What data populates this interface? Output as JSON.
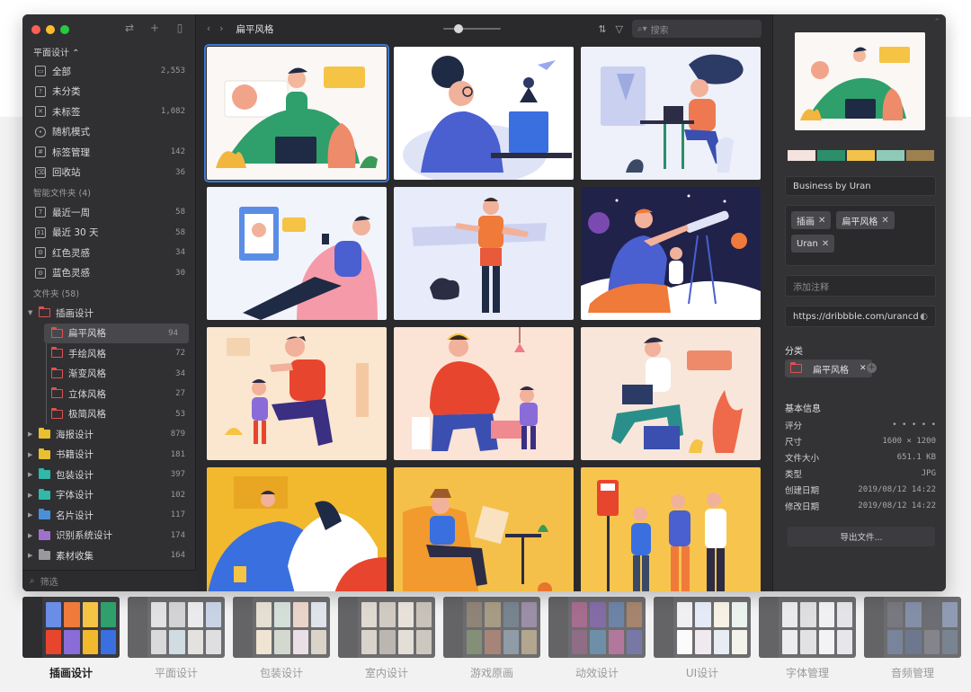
{
  "sidebar": {
    "library": "平面设计 ⌃",
    "items": [
      {
        "label": "全部",
        "count": "2,553",
        "icon": "all-icon"
      },
      {
        "label": "未分类",
        "count": "",
        "icon": "uncategorized-icon"
      },
      {
        "label": "未标签",
        "count": "1,082",
        "icon": "untagged-icon"
      },
      {
        "label": "随机模式",
        "count": "",
        "icon": "random-icon"
      },
      {
        "label": "标签管理",
        "count": "142",
        "icon": "tag-manage-icon"
      },
      {
        "label": "回收站",
        "count": "36",
        "icon": "trash-icon"
      }
    ],
    "smart_section": "智能文件夹 (4)",
    "smart_items": [
      {
        "label": "最近一周",
        "count": "58",
        "icon": "calendar-7-icon"
      },
      {
        "label": "最近 30 天",
        "count": "58",
        "icon": "calendar-31-icon"
      },
      {
        "label": "红色灵感",
        "count": "34",
        "icon": "smart-folder-icon"
      },
      {
        "label": "蓝色灵感",
        "count": "30",
        "icon": "smart-folder-icon"
      }
    ],
    "folder_section": "文件夹 (58)",
    "folders": [
      {
        "label": "插画设计",
        "count": "",
        "color": "#e05050",
        "expanded": true
      },
      {
        "label": "海报设计",
        "count": "879",
        "color": "#e8c030"
      },
      {
        "label": "书籍设计",
        "count": "181",
        "color": "#e8c030"
      },
      {
        "label": "包装设计",
        "count": "397",
        "color": "#30b8a8"
      },
      {
        "label": "字体设计",
        "count": "102",
        "color": "#30b8a8"
      },
      {
        "label": "名片设计",
        "count": "117",
        "color": "#4a90d8"
      },
      {
        "label": "识别系统设计",
        "count": "174",
        "color": "#a070d0"
      },
      {
        "label": "素材收集",
        "count": "164",
        "color": "#9a9a9e"
      }
    ],
    "subfolders": [
      {
        "label": "扁平风格",
        "count": "94"
      },
      {
        "label": "手绘风格",
        "count": "72"
      },
      {
        "label": "渐变风格",
        "count": "34"
      },
      {
        "label": "立体风格",
        "count": "27"
      },
      {
        "label": "极简风格",
        "count": "53"
      }
    ],
    "filter_placeholder": "筛选"
  },
  "toolbar": {
    "breadcrumb": "扁平风格",
    "search_placeholder": "搜索",
    "thumb_size_level": 0.22
  },
  "inspector": {
    "palette": [
      "#f5e3df",
      "#2a8f6a",
      "#f2c24a",
      "#8fcab8",
      "#9c8050"
    ],
    "title": "Business by Uran",
    "tags": [
      "插画",
      "扁平风格",
      "Uran"
    ],
    "note_placeholder": "添加注释",
    "url": "https://dribbble.com/urancd",
    "category_label": "分类",
    "category": "扁平风格",
    "info_label": "基本信息",
    "info": [
      {
        "key": "评分",
        "value": "• • • • •"
      },
      {
        "key": "尺寸",
        "value": "1600 × 1200"
      },
      {
        "key": "文件大小",
        "value": "651.1 KB"
      },
      {
        "key": "类型",
        "value": "JPG"
      },
      {
        "key": "创建日期",
        "value": "2019/08/12 14:22"
      },
      {
        "key": "修改日期",
        "value": "2019/08/12 14:22"
      }
    ],
    "export_label": "导出文件..."
  },
  "strip": {
    "labels": [
      "插画设计",
      "平面设计",
      "包装设计",
      "室内设计",
      "游戏原画",
      "动效设计",
      "UI设计",
      "字体管理",
      "音频管理"
    ],
    "active": 0
  }
}
